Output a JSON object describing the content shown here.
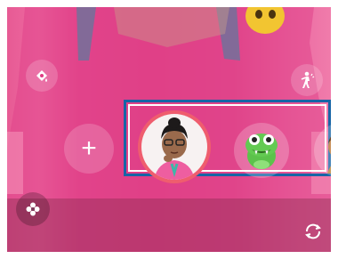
{
  "colors": {
    "background_pink": "#df3c83",
    "highlight_border": "#1665a6",
    "selected_ring": "#ef5d6e",
    "dino_green": "#5cc24b"
  },
  "controls": {
    "top_left_icon": "palette-icon",
    "top_right_icon": "person-walking-icon",
    "add_icon": "plus-icon",
    "add_symbol": "+",
    "bottom_left_icon": "flower-icon",
    "bottom_right_icon": "switch-camera-icon"
  },
  "emoji_list": {
    "items": [
      {
        "name": "avatar-girl",
        "selected": true
      },
      {
        "name": "dinosaur",
        "selected": false
      },
      {
        "name": "avatar-partial",
        "selected": false
      }
    ]
  },
  "modes": {
    "left": "",
    "right": ""
  }
}
